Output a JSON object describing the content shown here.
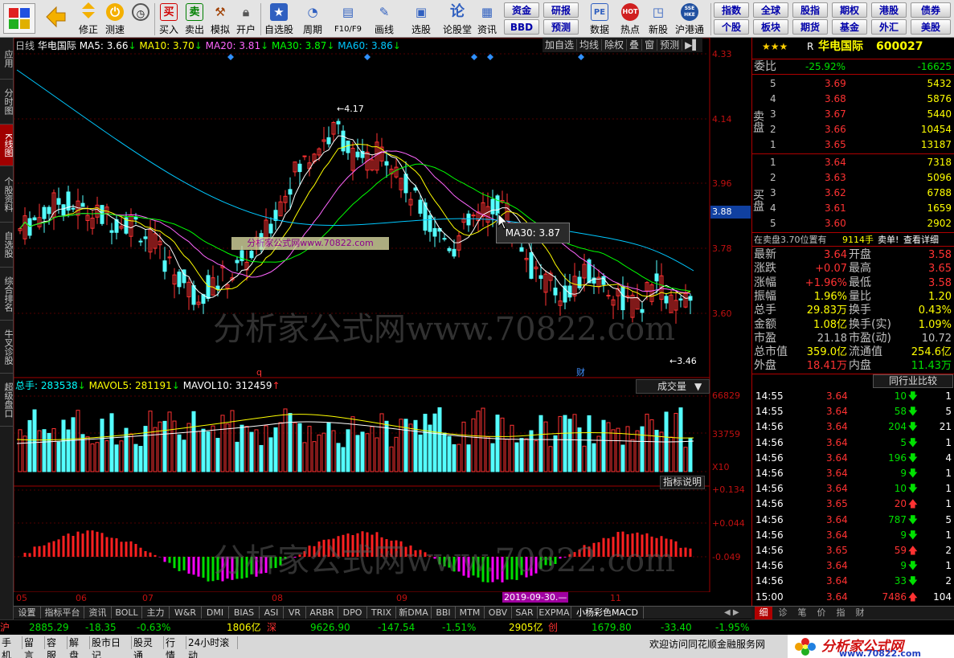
{
  "toolbar": {
    "buttons": [
      {
        "label": "修正",
        "icon": "back-arrow"
      },
      {
        "label": "测速",
        "icon": "clock"
      },
      {
        "label": "买入",
        "glyph": "买"
      },
      {
        "label": "卖出",
        "glyph": "卖"
      },
      {
        "label": "模拟",
        "icon": "hammer"
      },
      {
        "label": "开户",
        "icon": "lock"
      },
      {
        "label": "自选股",
        "icon": "star"
      },
      {
        "label": "周期",
        "icon": "clock"
      },
      {
        "label": "F10/F9",
        "icon": "document"
      },
      {
        "label": "画线",
        "icon": "pen"
      },
      {
        "label": "选股",
        "icon": "screen"
      },
      {
        "label": "论股堂",
        "glyph": "论"
      },
      {
        "label": "资讯",
        "icon": "news"
      },
      {
        "label": "数据",
        "glyph": "PE"
      },
      {
        "label": "热点",
        "glyph": "HOT"
      },
      {
        "label": "新股",
        "icon": "new"
      },
      {
        "label": "沪港通",
        "glyph": "SSE HKE"
      }
    ],
    "grid_buttons": [
      [
        "资金",
        "研报"
      ],
      [
        "BBD",
        "预测"
      ]
    ],
    "right_grid": [
      [
        "指数",
        "全球",
        "股指",
        "期权",
        "港股",
        "债券"
      ],
      [
        "个股",
        "板块",
        "期货",
        "基金",
        "外汇",
        "美股"
      ]
    ]
  },
  "left_tabs": [
    "应用",
    "分时图",
    "K线图",
    "个股资料",
    "自选股",
    "综合排名",
    "牛叉诊股",
    "超级盘口"
  ],
  "chart": {
    "period_label": "日线",
    "stock_name": "华电国际",
    "ma_legend": [
      {
        "text": "MA5: 3.66",
        "color": "#ffffff"
      },
      {
        "text": "MA10: 3.70",
        "color": "#ffff00"
      },
      {
        "text": "MA20: 3.81",
        "color": "#ff66ff"
      },
      {
        "text": "MA30: 3.87",
        "color": "#00ff00"
      },
      {
        "text": "MA60: 3.86",
        "color": "#00c8ff"
      }
    ],
    "chart_buttons": [
      "加自选",
      "均线",
      "除权",
      "叠",
      "窗",
      "预测"
    ],
    "price_axis": [
      "4.33",
      "4.14",
      "3.96",
      "3.78",
      "3.60"
    ],
    "current_price_tag": "3.88",
    "high_marker": "4.17",
    "low_marker": "3.46",
    "tooltip": "MA30: 3.87",
    "watermark": "分析家公式网www.70822.com",
    "inner_stamp": "分析家公式网www.70822.com",
    "q_marker": "q",
    "cai_marker": "财",
    "volume_legend": [
      {
        "text": "总手: 283538",
        "color": "#00ffff"
      },
      {
        "text": "MAVOL5: 281191",
        "color": "#ffff00"
      },
      {
        "text": "MAVOL10: 312459",
        "color": "#ffffff"
      }
    ],
    "volume_axis": [
      "66829",
      "33759"
    ],
    "volume_unit": "X10",
    "volume_dropdown": "成交量",
    "indicator_help": "指标说明",
    "macd_axis": [
      "+0.134",
      "+0.044",
      "-0.049"
    ],
    "months": [
      "05",
      "06",
      "07",
      "08",
      "09",
      "11"
    ],
    "date_tag": "2019-09-30.—"
  },
  "quote": {
    "title": "华电国际",
    "code": "600027",
    "stars": "★★★",
    "r_tag": "R",
    "weibi": {
      "label": "委比",
      "pct": "-25.92%",
      "diff": "-16625"
    },
    "sell_label": "卖盘",
    "buy_label": "买盘",
    "asks": [
      {
        "lvl": "5",
        "price": "3.69",
        "vol": "5432"
      },
      {
        "lvl": "4",
        "price": "3.68",
        "vol": "5876"
      },
      {
        "lvl": "3",
        "price": "3.67",
        "vol": "5440"
      },
      {
        "lvl": "2",
        "price": "3.66",
        "vol": "10454"
      },
      {
        "lvl": "1",
        "price": "3.65",
        "vol": "13187"
      }
    ],
    "bids": [
      {
        "lvl": "1",
        "price": "3.64",
        "vol": "7318"
      },
      {
        "lvl": "2",
        "price": "3.63",
        "vol": "5096"
      },
      {
        "lvl": "3",
        "price": "3.62",
        "vol": "6788"
      },
      {
        "lvl": "4",
        "price": "3.61",
        "vol": "1659"
      },
      {
        "lvl": "5",
        "price": "3.60",
        "vol": "2902"
      }
    ],
    "notice": "在卖盘3.70位置有",
    "notice_vol": "9114手",
    "notice_type": "卖单!",
    "notice_link": "查看详细",
    "stats": [
      {
        "k1": "最新",
        "v1": "3.64",
        "k2": "开盘",
        "v2": "3.58"
      },
      {
        "k1": "涨跌",
        "v1": "+0.07",
        "k2": "最高",
        "v2": "3.65"
      },
      {
        "k1": "涨幅",
        "v1": "+1.96%",
        "k2": "最低",
        "v2": "3.58"
      },
      {
        "k1": "振幅",
        "v1": "1.96%",
        "k2": "量比",
        "v2": "1.20"
      },
      {
        "k1": "总手",
        "v1": "29.83万",
        "k2": "换手",
        "v2": "0.43%"
      },
      {
        "k1": "金额",
        "v1": "1.08亿",
        "k2": "换手(实)",
        "v2": "1.09%"
      },
      {
        "k1": "市盈",
        "v1": "21.18",
        "k2": "市盈(动)",
        "v2": "10.72"
      },
      {
        "k1": "总市值",
        "v1": "359.0亿",
        "k2": "流通值",
        "v2": "254.6亿"
      },
      {
        "k1": "外盘",
        "v1": "18.41万",
        "k2": "内盘",
        "v2": "11.43万"
      }
    ],
    "compare_label": "同行业比较",
    "ticks": [
      {
        "t": "14:55",
        "p": "3.64",
        "v": "10",
        "d": "down",
        "n": "1"
      },
      {
        "t": "14:55",
        "p": "3.64",
        "v": "58",
        "d": "down",
        "n": "5"
      },
      {
        "t": "14:56",
        "p": "3.64",
        "v": "204",
        "d": "down",
        "n": "21"
      },
      {
        "t": "14:56",
        "p": "3.64",
        "v": "5",
        "d": "down",
        "n": "1"
      },
      {
        "t": "14:56",
        "p": "3.64",
        "v": "196",
        "d": "down",
        "n": "4"
      },
      {
        "t": "14:56",
        "p": "3.64",
        "v": "9",
        "d": "down",
        "n": "1"
      },
      {
        "t": "14:56",
        "p": "3.64",
        "v": "10",
        "d": "down",
        "n": "1"
      },
      {
        "t": "14:56",
        "p": "3.65",
        "v": "20",
        "d": "up",
        "n": "1"
      },
      {
        "t": "14:56",
        "p": "3.64",
        "v": "787",
        "d": "down",
        "n": "5"
      },
      {
        "t": "14:56",
        "p": "3.64",
        "v": "9",
        "d": "down",
        "n": "1"
      },
      {
        "t": "14:56",
        "p": "3.65",
        "v": "59",
        "d": "up",
        "n": "2"
      },
      {
        "t": "14:56",
        "p": "3.64",
        "v": "9",
        "d": "down",
        "n": "1"
      },
      {
        "t": "14:56",
        "p": "3.64",
        "v": "33",
        "d": "down",
        "n": "2"
      },
      {
        "t": "15:00",
        "p": "3.64",
        "v": "7486",
        "d": "up",
        "n": "104"
      }
    ],
    "bottom_tabs": [
      "细",
      "诊",
      "笔",
      "价",
      "指",
      "财"
    ]
  },
  "indicator_tabs": [
    "设置",
    "指标平台",
    "资讯",
    "BOLL",
    "主力",
    "W&R",
    "DMI",
    "BIAS",
    "ASI",
    "VR",
    "ARBR",
    "DPO",
    "TRIX",
    "新DMA",
    "BBI",
    "MTM",
    "OBV",
    "SAR",
    "EXPMA",
    "小杨彩色MACD"
  ],
  "index_bar": {
    "sh_label": "沪",
    "sh_val": "2885.29",
    "sh_chg": "-18.35",
    "sh_pct": "-0.63%",
    "sh_amt": "1806亿",
    "sz_label": "深",
    "sz_val": "9626.90",
    "sz_chg": "-147.54",
    "sz_pct": "-1.51%",
    "sz_amt": "2905亿",
    "cy_label": "创",
    "cy_val": "1679.80",
    "cy_chg": "-33.40",
    "cy_pct": "-1.95%"
  },
  "status_bar": {
    "items": [
      "手机",
      "留言",
      "容服",
      "解盘",
      "股市日记",
      "股灵通",
      "行情",
      "24小时滚动"
    ],
    "welcome": "欢迎访问同花顺金融服务网",
    "brand": "分析家公式网",
    "brand_url": "www.70822.com"
  }
}
